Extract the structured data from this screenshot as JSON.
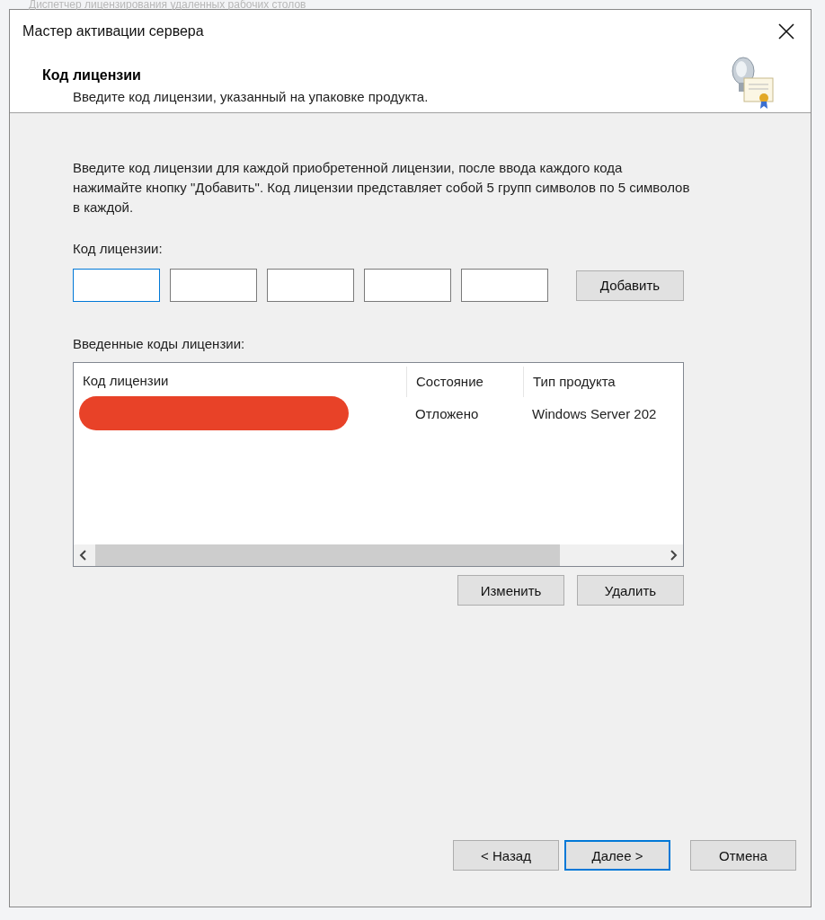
{
  "background_window": {
    "title": "Диспетчер лицензирования удаленных рабочих столов"
  },
  "window": {
    "title": "Мастер активации сервера"
  },
  "header": {
    "title": "Код лицензии",
    "subtitle": "Введите код лицензии, указанный на упаковке продукта."
  },
  "intro": "Введите код лицензии для каждой приобретенной лицензии, после ввода каждого кода нажимайте кнопку \"Добавить\". Код лицензии представляет собой 5 групп символов по 5 символов в каждой.",
  "key_label": "Код лицензии:",
  "key_fields": [
    {
      "focused": true
    },
    {
      "focused": false
    },
    {
      "focused": false
    },
    {
      "focused": false
    },
    {
      "focused": false
    }
  ],
  "add_button": "Добавить",
  "list_label": "Введенные коды лицензии:",
  "table": {
    "columns": [
      "Код лицензии",
      "Состояние",
      "Тип продукта"
    ],
    "rows": [
      {
        "redacted": true,
        "cells": [
          "",
          "Отложено",
          "Windows Server 202"
        ]
      }
    ]
  },
  "list_buttons": [
    "Изменить",
    "Удалить"
  ],
  "footer_buttons": [
    {
      "label": "< Назад",
      "default": false
    },
    {
      "label": "Далее >",
      "default": true
    },
    {
      "label": "Отмена",
      "default": false
    }
  ]
}
